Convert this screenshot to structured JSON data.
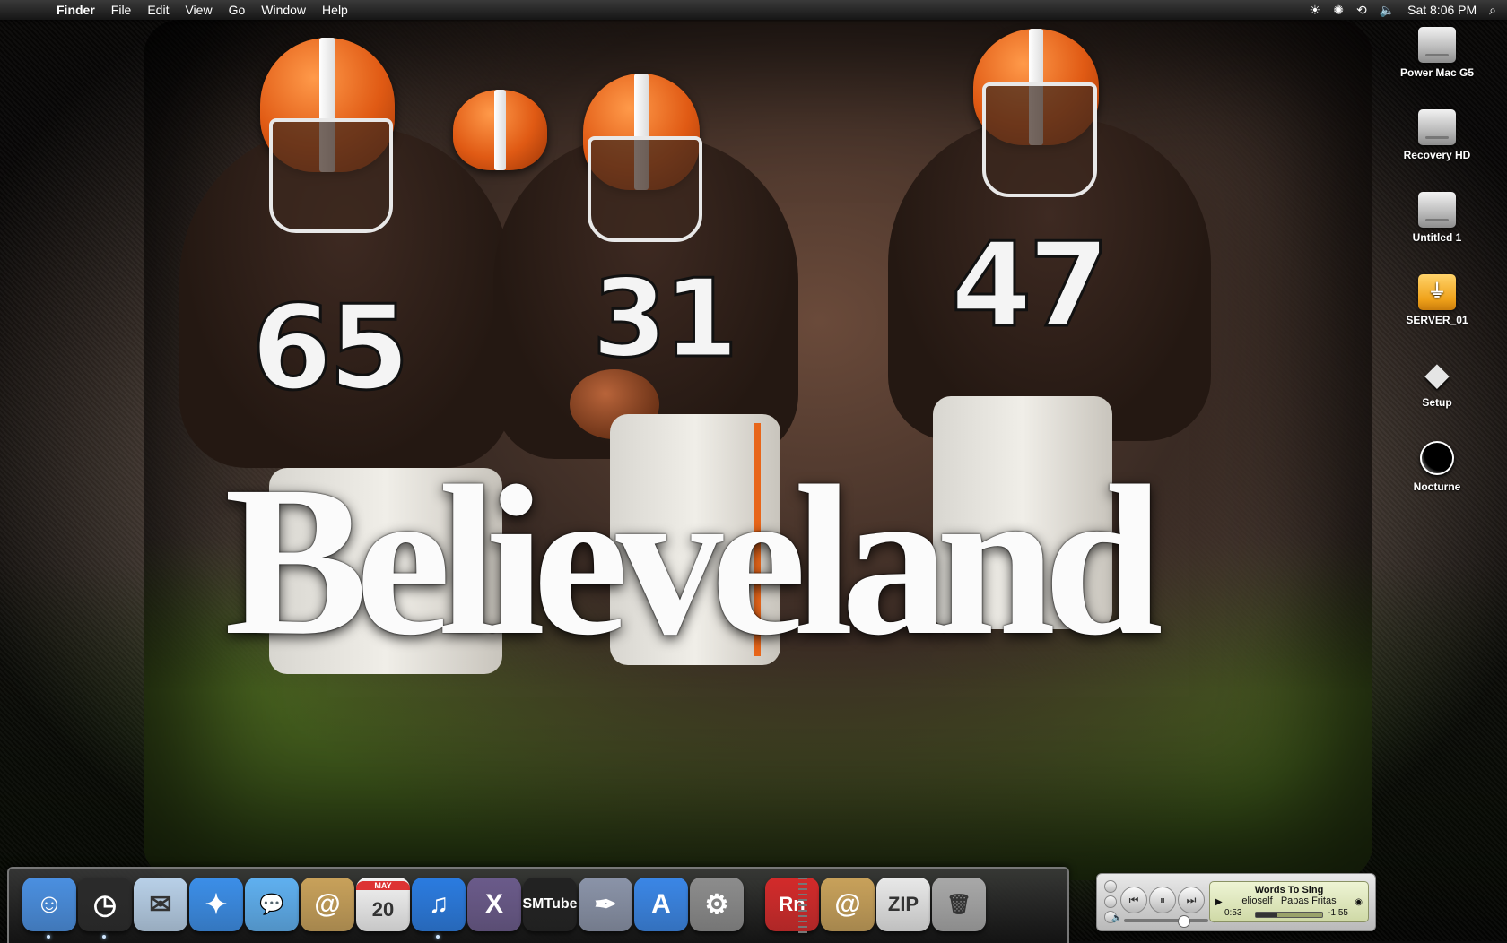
{
  "menubar": {
    "apple": "",
    "app_name": "Finder",
    "menus": [
      "File",
      "Edit",
      "View",
      "Go",
      "Window",
      "Help"
    ],
    "status": {
      "brightness_icon": "☀",
      "gear_icon": "✺",
      "time_machine_icon": "⟲",
      "volume_icon": "🔈",
      "clock": "Sat 8:06 PM",
      "spotlight_icon": "⌕"
    }
  },
  "wallpaper": {
    "headline": "Believeland",
    "jersey_numbers": [
      "65",
      "31",
      "47"
    ]
  },
  "desktop_icons": [
    {
      "label": "Power Mac G5",
      "type": "disk"
    },
    {
      "label": "Recovery HD",
      "type": "disk"
    },
    {
      "label": "Untitled 1",
      "type": "disk"
    },
    {
      "label": "SERVER_01",
      "type": "usb"
    },
    {
      "label": "Setup",
      "type": "setup"
    },
    {
      "label": "Nocturne",
      "type": "nocturne"
    }
  ],
  "dock": {
    "items": [
      {
        "name": "finder",
        "glyph": "☺",
        "color": "#4a8fe0",
        "running": true
      },
      {
        "name": "dashboard",
        "glyph": "◷",
        "color": "#2a2a2a",
        "running": true
      },
      {
        "name": "mail-stamp",
        "glyph": "✉",
        "color": "#b8d0e8",
        "running": false
      },
      {
        "name": "bluebird",
        "glyph": "✦",
        "color": "#3b8ee8",
        "running": false
      },
      {
        "name": "ichat",
        "glyph": "💬",
        "color": "#5fb0f0",
        "running": false
      },
      {
        "name": "address-book",
        "glyph": "@",
        "color": "#c8a15a",
        "running": false
      },
      {
        "name": "calendar",
        "glyph": "20",
        "label_small": "MAY",
        "color": "#f2f2f2",
        "running": false
      },
      {
        "name": "itunes",
        "glyph": "♫",
        "color": "#2a7be0",
        "running": true
      },
      {
        "name": "xcode",
        "glyph": "X",
        "color": "#6a5a8a",
        "running": false
      },
      {
        "name": "smtube",
        "glyph": "SMTube",
        "color": "#222222",
        "running": false
      },
      {
        "name": "script-editor",
        "glyph": "✒",
        "color": "#8a93a8",
        "running": false
      },
      {
        "name": "app-store",
        "glyph": "A",
        "color": "#3a86e6",
        "running": false
      },
      {
        "name": "system-preferences",
        "glyph": "⚙",
        "color": "#8c8c8c",
        "running": false
      },
      {
        "name": "rn",
        "glyph": "Rn",
        "color": "#d32a2a",
        "running": false
      },
      {
        "name": "mail-folder",
        "glyph": "@",
        "color": "#c8a15a",
        "running": false
      },
      {
        "name": "zip-archive",
        "glyph": "ZIP",
        "color": "#e8e8e8",
        "running": false
      },
      {
        "name": "trash",
        "glyph": "🗑",
        "color": "#a8a8a8",
        "running": false
      }
    ]
  },
  "itunes_controller": {
    "song": "Words To Sing",
    "artist": "elioself",
    "album": "Papas Fritas",
    "elapsed": "0:53",
    "remaining": "-1:55",
    "progress": 0.33,
    "volume": 0.75,
    "prev_icon": "⏮",
    "pause_icon": "⏸",
    "next_icon": "⏭"
  }
}
